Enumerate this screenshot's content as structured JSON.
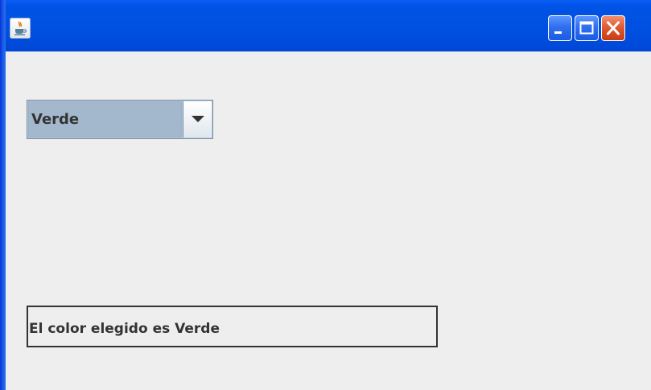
{
  "window": {
    "title": "",
    "app_icon": "java-cup-icon",
    "controls": {
      "minimize_icon": "minimize-icon",
      "maximize_icon": "maximize-icon",
      "close_icon": "close-icon"
    },
    "colors": {
      "titlebar": "#0054e3",
      "content_bg": "#eeeeee",
      "close_button": "#e15a31"
    }
  },
  "combo": {
    "selected": "Verde",
    "arrow_icon": "chevron-down-icon"
  },
  "result_label": {
    "text": "El color elegido es Verde"
  }
}
